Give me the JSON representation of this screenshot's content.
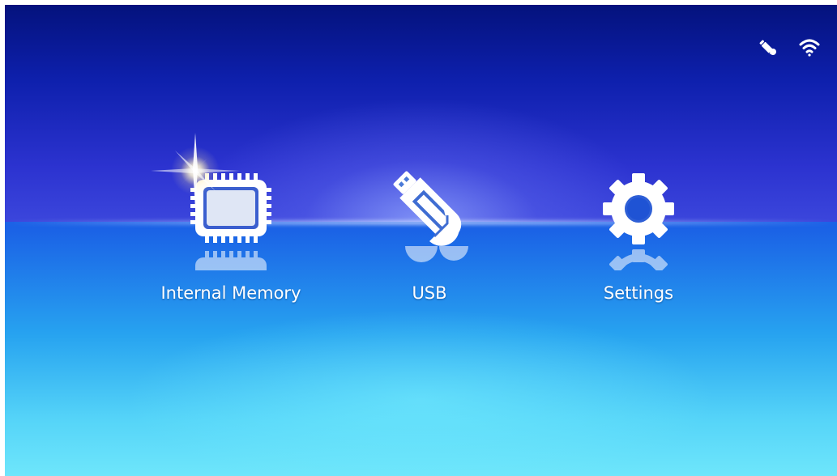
{
  "status_bar": {
    "icons": [
      "pen-icon",
      "wifi-icon"
    ]
  },
  "menu": {
    "items": [
      {
        "label": "Internal Memory",
        "icon": "memory-chip-icon",
        "selected": true
      },
      {
        "label": "USB",
        "icon": "usb-drive-icon",
        "selected": false
      },
      {
        "label": "Settings",
        "icon": "gear-icon",
        "selected": false
      }
    ]
  },
  "colors": {
    "sky_top": "#04127d",
    "floor_bottom": "#6ee6fb",
    "icon_fill": "#ffffff",
    "label": "#ffffff"
  }
}
